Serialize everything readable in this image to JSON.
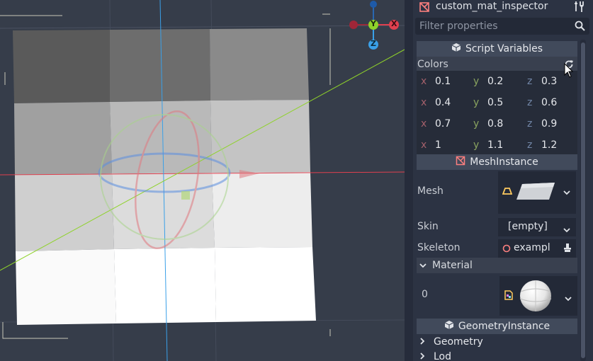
{
  "inspector": {
    "node_name": "custom_mat_inspector",
    "node_icon": "mesh-instance-icon",
    "filter_placeholder": "Filter properties",
    "sections": {
      "script_variables": "Script Variables",
      "colors_label": "Colors",
      "vectors": [
        {
          "x": "0.1",
          "y": "0.2",
          "z": "0.3"
        },
        {
          "x": "0.4",
          "y": "0.5",
          "z": "0.6"
        },
        {
          "x": "0.7",
          "y": "0.8",
          "z": "0.9"
        },
        {
          "x": "1",
          "y": "1.1",
          "z": "1.2"
        }
      ],
      "axis": {
        "x": "x",
        "y": "y",
        "z": "z"
      },
      "mesh_instance": "MeshInstance",
      "mesh_label": "Mesh",
      "skin_label": "Skin",
      "skin_value": "[empty]",
      "skeleton_label": "Skeleton",
      "skeleton_value": "exampl",
      "material_label": "Material",
      "material_index": "0",
      "geometry_instance": "GeometryInstance",
      "geometry_label": "Geometry",
      "lod_label": "Lod"
    }
  },
  "gizmo": {
    "y": "Y",
    "z": "Z",
    "x": "X"
  },
  "colors": {
    "x_axis": "#e0404f",
    "y_axis": "#8fd22a",
    "z_axis": "#3aa0e8",
    "panel_bg": "#2c3343",
    "viewport_bg": "#363d4a"
  }
}
